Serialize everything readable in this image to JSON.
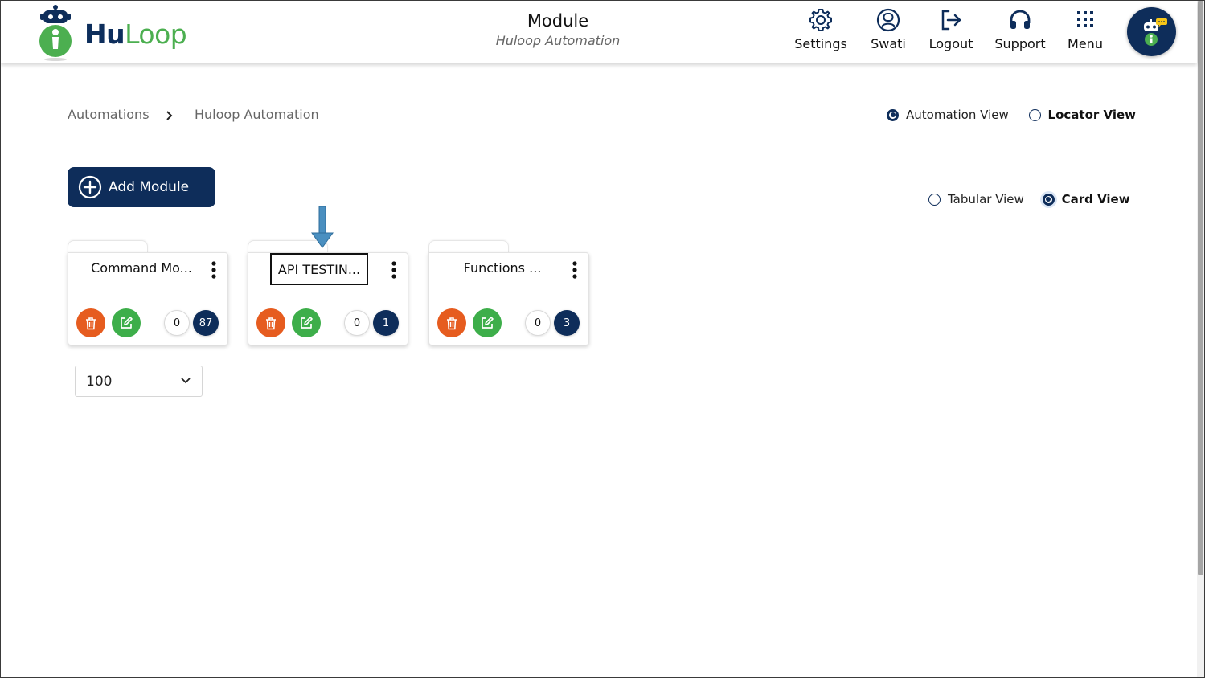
{
  "header": {
    "logo": {
      "part1": "Hu",
      "part2": "Loop"
    },
    "title": "Module",
    "subtitle": "Huloop Automation",
    "nav": [
      {
        "label": "Settings",
        "icon": "gear-icon"
      },
      {
        "label": "Swati",
        "icon": "user-icon"
      },
      {
        "label": "Logout",
        "icon": "logout-icon"
      },
      {
        "label": "Support",
        "icon": "headphones-icon"
      },
      {
        "label": "Menu",
        "icon": "grid-icon"
      }
    ],
    "avatar_icon": "robot-assistant-icon"
  },
  "breadcrumb": {
    "root": "Automations",
    "separator": ">",
    "current": "Huloop Automation"
  },
  "view_toggle": {
    "automation_view": "Automation View",
    "locator_view": "Locator View",
    "selected": "automation_view"
  },
  "display_toggle": {
    "tabular_view": "Tabular View",
    "card_view": "Card View",
    "selected": "card_view"
  },
  "toolbar": {
    "add_module_label": "Add Module"
  },
  "cards": [
    {
      "name": "Command Mo...",
      "count_left": "0",
      "count_right": "87"
    },
    {
      "name": "API TESTIN...",
      "count_left": "0",
      "count_right": "1"
    },
    {
      "name": "Functions ...",
      "count_left": "0",
      "count_right": "3"
    }
  ],
  "pagination": {
    "page_size": "100"
  },
  "colors": {
    "primary": "#0e2d5a",
    "delete": "#e65c1f",
    "edit": "#3dae4a",
    "brand_green": "#4caf50"
  }
}
